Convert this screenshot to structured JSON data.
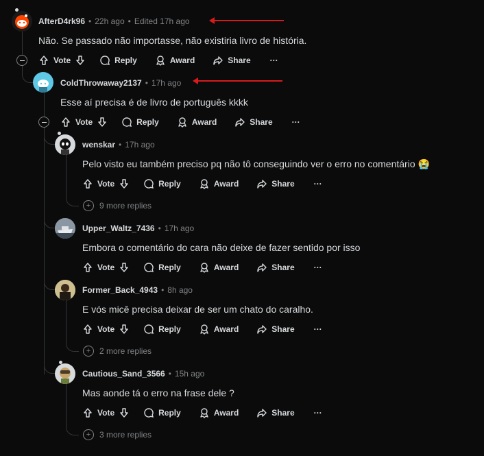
{
  "actions": {
    "vote": "Vote",
    "reply": "Reply",
    "award": "Award",
    "share": "Share",
    "more": "···"
  },
  "comments": [
    {
      "author": "AfterD4rk96",
      "time": "22h ago",
      "edited": "Edited 17h ago",
      "text": "Não. Se passado não importasse, não existiria livro de história."
    },
    {
      "author": "ColdThrowaway2137",
      "time": "17h ago",
      "text": "Esse aí precisa é de livro de português kkkk"
    },
    {
      "author": "wenskar",
      "time": "17h ago",
      "text": "Pelo visto eu também preciso pq não tô conseguindo ver o erro no comentário 😭",
      "more_replies": "9 more replies"
    },
    {
      "author": "Upper_Waltz_7436",
      "time": "17h ago",
      "text": "Embora o comentário do cara não deixe de fazer sentido por isso"
    },
    {
      "author": "Former_Back_4943",
      "time": "8h ago",
      "text": "E vós micê precisa deixar de ser um chato do caralho.",
      "more_replies": "2 more replies"
    },
    {
      "author": "Cautious_Sand_3566",
      "time": "15h ago",
      "text": "Mas aonde tá o erro na frase dele ?",
      "more_replies": "3 more replies"
    }
  ],
  "colors": {
    "background": "#0b0b0c",
    "annotation_arrow": "#d71b1b",
    "thread_line": "#343536"
  }
}
